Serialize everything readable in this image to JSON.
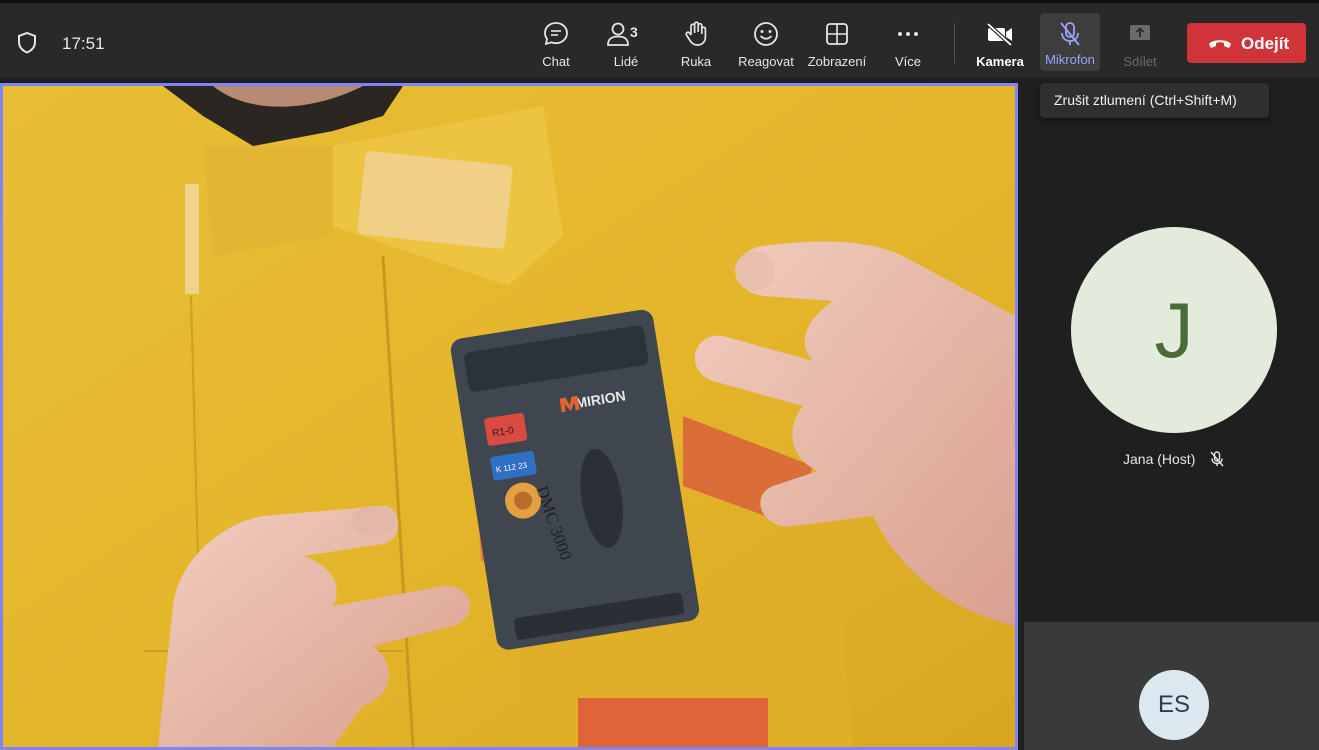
{
  "header": {
    "time": "17:51",
    "toolbar": [
      {
        "id": "chat",
        "label": "Chat",
        "icon": "chat-icon"
      },
      {
        "id": "people",
        "label": "Lidé",
        "icon": "people-icon",
        "badge": "3"
      },
      {
        "id": "raise-hand",
        "label": "Ruka",
        "icon": "hand-icon"
      },
      {
        "id": "react",
        "label": "Reagovat",
        "icon": "smiley-icon"
      },
      {
        "id": "view",
        "label": "Zobrazení",
        "icon": "grid-icon"
      },
      {
        "id": "more",
        "label": "Více",
        "icon": "more-icon"
      },
      {
        "id": "camera",
        "label": "Kamera",
        "icon": "camera-off-icon"
      },
      {
        "id": "microphone",
        "label": "Mikrofon",
        "icon": "mic-off-icon"
      },
      {
        "id": "share",
        "label": "Sdílet",
        "icon": "share-icon"
      }
    ],
    "leave_label": "Odejít"
  },
  "tooltip": "Zrušit ztlumení (Ctrl+Shift+M)",
  "participants": [
    {
      "initials": "J",
      "name": "Jana (Host)",
      "muted": true,
      "avatar_color": "#e3ebdc",
      "initials_color": "#4b6b3a"
    },
    {
      "initials": "ES",
      "avatar_color": "#dce8ef",
      "initials_color": "#2c3e4d"
    }
  ],
  "main_video": {
    "device_brand": "MIRION",
    "device_model": "DMC 3000",
    "sticker_red": "R1-0",
    "sticker_blue": "K 112 23"
  },
  "colors": {
    "accent": "#7f85f5",
    "leave": "#d13438",
    "toolbar_bg": "#292929"
  }
}
